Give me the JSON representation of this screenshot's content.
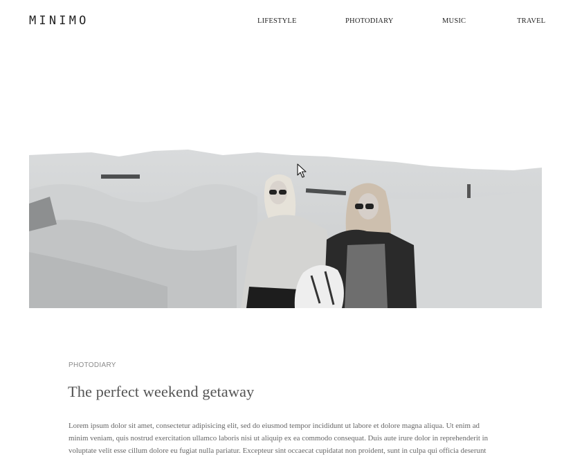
{
  "header": {
    "logo": "MINIMO",
    "nav": [
      {
        "label": "LIFESTYLE"
      },
      {
        "label": "PHOTODIARY"
      },
      {
        "label": "MUSIC"
      },
      {
        "label": "TRAVEL"
      }
    ]
  },
  "post": {
    "category": "PHOTODIARY",
    "title": "The perfect weekend getaway",
    "excerpt": "Lorem ipsum dolor sit amet, consectetur adipisicing elit, sed do eiusmod tempor incididunt ut labore et dolore magna aliqua. Ut enim ad minim veniam, quis nostrud exercitation ullamco laboris nisi ut aliquip ex ea commodo consequat. Duis aute irure dolor in reprehenderit in voluptate velit esse cillum dolore eu fugiat nulla pariatur. Excepteur sint occaecat cupidatat non proident, sunt in culpa qui officia deserunt"
  }
}
